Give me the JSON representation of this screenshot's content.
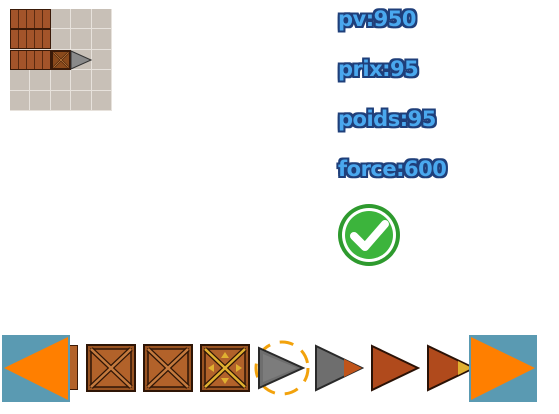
{
  "stats": {
    "pv": "pv:950",
    "prix": "prix:95",
    "poids": "poids:95",
    "force": "force:600"
  },
  "colors": {
    "stat_fill": "#4aa8ee",
    "stat_outline": "#1f3f7a",
    "confirm_green": "#3cb43c",
    "arrow_orange": "#ff7f00",
    "arrow_bg": "#5a9ab2",
    "selection_ring": "#f2a20c"
  },
  "icons": {
    "confirm": "checkmark-icon",
    "prev": "left-arrow-icon",
    "next": "right-arrow-icon"
  },
  "selector": {
    "items": [
      {
        "name": "wooden-crate",
        "selected": false
      },
      {
        "name": "wooden-crate",
        "selected": false
      },
      {
        "name": "gold-trimmed-crate",
        "selected": false
      },
      {
        "name": "grey-spike",
        "selected": true
      },
      {
        "name": "grey-spike-orange-tip",
        "selected": false
      },
      {
        "name": "rust-spike",
        "selected": false
      },
      {
        "name": "rust-spike-gold-tip",
        "selected": false
      }
    ]
  }
}
